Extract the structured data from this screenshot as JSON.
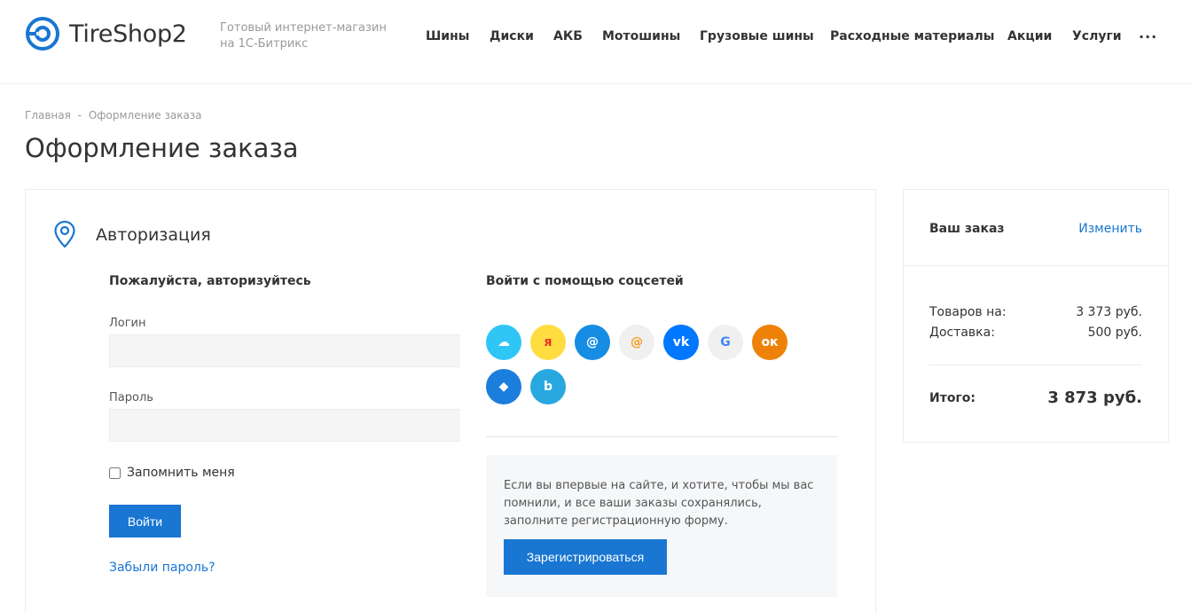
{
  "header": {
    "logo_text": "TireShop2",
    "tagline": "Готовый интернет-магазин на 1С-Битрикс",
    "nav": [
      {
        "label": "Шины"
      },
      {
        "label": "Диски"
      },
      {
        "label": "АКБ"
      },
      {
        "label": "Мотошины"
      },
      {
        "label": "Грузовые шины"
      },
      {
        "label": "Расходные материалы"
      },
      {
        "label": "Акции"
      },
      {
        "label": "Услуги"
      }
    ],
    "more": "···"
  },
  "breadcrumb": {
    "home": "Главная",
    "separator": "-",
    "current": "Оформление заказа"
  },
  "page_title": "Оформление заказа",
  "auth": {
    "title": "Авторизация",
    "login_column_title": "Пожалуйста, авторизуйтесь",
    "login_label": "Логин",
    "login_value": "",
    "password_label": "Пароль",
    "password_value": "",
    "remember_label": "Запомнить меня",
    "remember_checked": false,
    "submit_label": "Войти",
    "forgot_label": "Забыли пароль?",
    "social_title": "Войти с помощью соцсетей",
    "social": [
      {
        "icon": "bitrix24-icon",
        "glyph": "☁",
        "color": "#2fc6f6"
      },
      {
        "icon": "yandex-icon",
        "glyph": "я",
        "color": "#ffdd40"
      },
      {
        "icon": "mailru-icon",
        "glyph": "@",
        "color": "#168de2"
      },
      {
        "icon": "mail-icon",
        "glyph": "@",
        "color": "#f0f0f0"
      },
      {
        "icon": "vk-icon",
        "glyph": "vk",
        "color": "#0077ff"
      },
      {
        "icon": "google-icon",
        "glyph": "G",
        "color": "#f0f0f0"
      },
      {
        "icon": "odnoklassniki-icon",
        "glyph": "ок",
        "color": "#ee8208"
      },
      {
        "icon": "dropbox-icon",
        "glyph": "◆",
        "color": "#1b7ddc"
      },
      {
        "icon": "bitrix-b-icon",
        "glyph": "b",
        "color": "#29a8e0"
      }
    ],
    "register_text": "Если вы впервые на сайте, и хотите, чтобы мы вас помнили, и все ваши заказы сохранялись, заполните регистрационную форму.",
    "register_button": "Зарегистрироваться"
  },
  "order": {
    "title": "Ваш заказ",
    "edit": "Изменить",
    "items_label": "Товаров на:",
    "items_value": "3 373 руб.",
    "delivery_label": "Доставка:",
    "delivery_value": "500 руб.",
    "total_label": "Итого:",
    "total_value": "3 873 руб."
  },
  "colors": {
    "accent": "#1976d2",
    "text": "#333333",
    "muted": "#999999"
  }
}
